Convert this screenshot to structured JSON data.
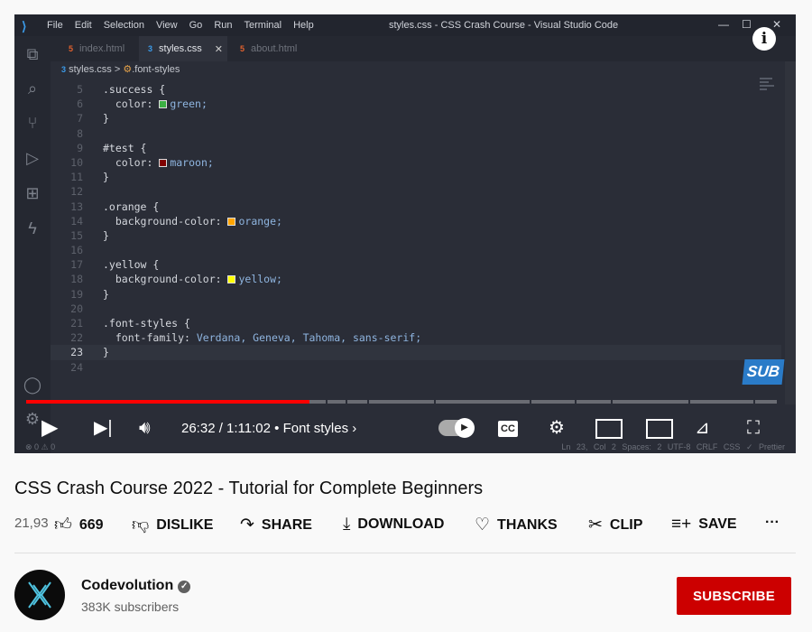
{
  "vscode": {
    "menu": [
      "File",
      "Edit",
      "Selection",
      "View",
      "Go",
      "Run",
      "Terminal",
      "Help"
    ],
    "window_title": "styles.css - CSS Crash Course - Visual Studio Code",
    "tabs": [
      {
        "label": "index.html",
        "icon": "html5-icon"
      },
      {
        "label": "styles.css",
        "icon": "css3-icon",
        "active": true
      },
      {
        "label": "about.html",
        "icon": "html5-icon"
      }
    ],
    "breadcrumb": {
      "file": "styles.css",
      "sep": ">",
      "symbol": ".font-styles"
    },
    "code": [
      {
        "n": "5",
        "selector": ".success {"
      },
      {
        "n": "6",
        "prop": "color: ",
        "swatch": "#3cb043",
        "value": "green;"
      },
      {
        "n": "7",
        "selector": "}"
      },
      {
        "n": "8"
      },
      {
        "n": "9",
        "selector": "#test {"
      },
      {
        "n": "10",
        "prop": "color: ",
        "swatch": "#800000",
        "value": "maroon;"
      },
      {
        "n": "11",
        "selector": "}"
      },
      {
        "n": "12"
      },
      {
        "n": "13",
        "selector": ".orange {"
      },
      {
        "n": "14",
        "prop": "background-color: ",
        "swatch": "#ffa500",
        "value": "orange;"
      },
      {
        "n": "15",
        "selector": "}"
      },
      {
        "n": "16"
      },
      {
        "n": "17",
        "selector": ".yellow {"
      },
      {
        "n": "18",
        "prop": "background-color: ",
        "swatch": "#ffff00",
        "value": "yellow;"
      },
      {
        "n": "19",
        "selector": "}"
      },
      {
        "n": "20"
      },
      {
        "n": "21",
        "selector": ".font-styles {"
      },
      {
        "n": "22",
        "prop": "font-family: ",
        "value": "Verdana, Geneva, Tahoma, sans-serif;"
      },
      {
        "n": "23",
        "selector": "}",
        "current": true
      },
      {
        "n": "24"
      }
    ],
    "status_left": "⊗ 0 ⚠ 0",
    "status_right": "Ln 23, Col 2   Spaces: 2   UTF-8   CRLF   CSS   ✓ Prettier"
  },
  "player": {
    "info": "i",
    "sub_badge": "SUB",
    "time": "26:32 / 1:11:02",
    "chapter": "• Font styles",
    "progress_percent": 37.4,
    "cc": "CC",
    "accent": "#ff0000"
  },
  "video": {
    "title": "CSS Crash Course 2022 - Tutorial for Complete Beginners",
    "views": "21,93",
    "likes": "669",
    "dislike": "DISLIKE",
    "share": "SHARE",
    "download": "DOWNLOAD",
    "thanks": "THANKS",
    "clip": "CLIP",
    "save": "SAVE",
    "more": "···"
  },
  "channel": {
    "name": "Codevolution",
    "subscribers": "383K subscribers",
    "subscribe": "SUBSCRIBE",
    "subscribe_color": "#cc0000"
  }
}
